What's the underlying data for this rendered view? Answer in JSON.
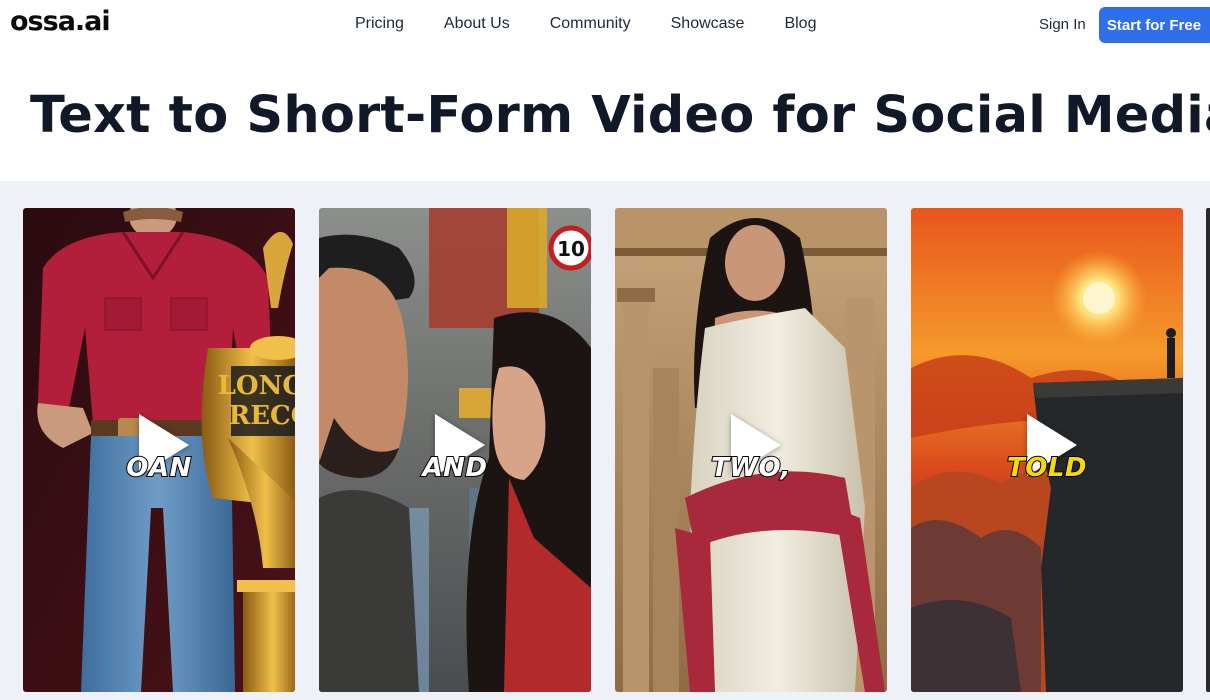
{
  "brand": {
    "logo": "ossa.ai"
  },
  "nav": {
    "links": [
      "Pricing",
      "About Us",
      "Community",
      "Showcase",
      "Blog"
    ],
    "sign_in": "Sign In",
    "cta": "Start for Free"
  },
  "hero": {
    "title": "Text to Short-Form Video for Social Media"
  },
  "gallery": {
    "cards": [
      {
        "caption": "OAN",
        "icon": "play-icon"
      },
      {
        "caption": "AND",
        "icon": "play-icon"
      },
      {
        "caption": "TWO,",
        "icon": "play-icon"
      },
      {
        "caption": "TOLD",
        "icon": "play-icon"
      }
    ],
    "trophy_text": "LONGE RECO",
    "sign_number": "10"
  },
  "colors": {
    "accent": "#2f6fe9",
    "gallery_bg": "#eef1f7",
    "caption_highlight": "#f5d90f"
  }
}
